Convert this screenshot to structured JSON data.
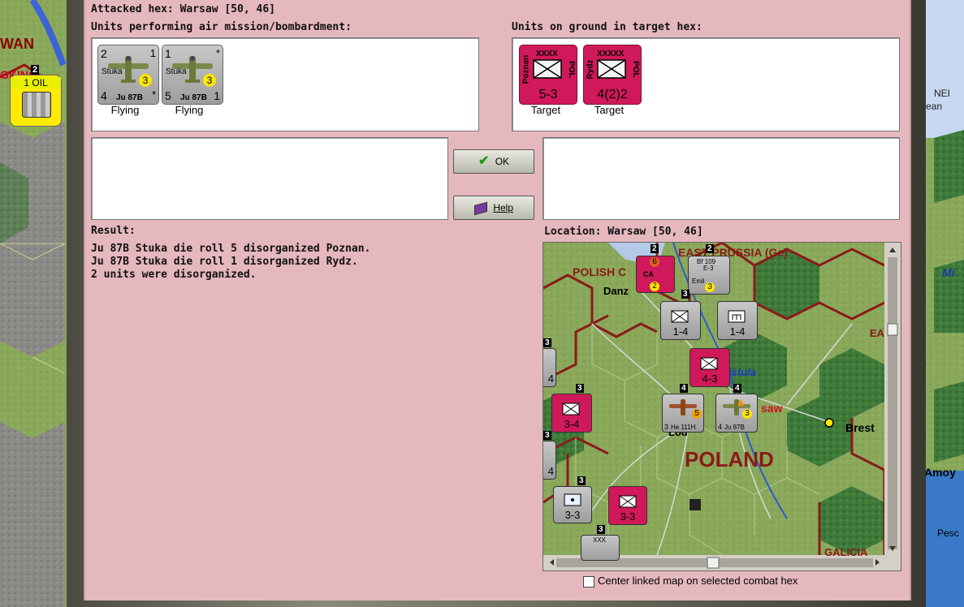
{
  "dialog": {
    "attacked_hex": "Attacked hex: Warsaw  [50, 46]",
    "air_units_header": "Units performing air mission/bombardment:",
    "ground_units_header": "Units on ground in target hex:",
    "result_header": "Result:",
    "location_header": "Location:  Warsaw  [50, 46]",
    "ok_label": "OK",
    "help_label": "Help",
    "center_checkbox_label": "Center linked map on selected combat hex",
    "center_checked": false
  },
  "air_units": [
    {
      "left_top": "2",
      "right_top": "1",
      "name": "Stuka",
      "model": "Ju 87B",
      "left_bottom": "4",
      "right_bottom": "*",
      "badge": "3",
      "status": "Flying"
    },
    {
      "left_top": "1",
      "right_top": "*",
      "name": "Stuka",
      "model": "Ju 87B",
      "left_bottom": "5",
      "right_bottom": "1",
      "badge": "3",
      "status": "Flying"
    }
  ],
  "ground_units": [
    {
      "name": "Poznan",
      "size": "XXXX",
      "nation": "POL",
      "strength": "5-3",
      "status": "Target"
    },
    {
      "name": "Rydz",
      "size": "XXXXX",
      "nation": "POL",
      "strength": "4(2)2",
      "status": "Target"
    }
  ],
  "results": [
    "Ju 87B Stuka die roll 5 disorganized Poznan.",
    "Ju 87B Stuka die roll 1 disorganized Rydz.",
    "2 units were disorganized."
  ],
  "background_map": {
    "left_labels": [
      "WAN",
      "GKING"
    ],
    "oil_label": "1 OIL",
    "oil_count": "2",
    "right_labels": [
      "Mi",
      "NEI",
      "ean",
      "Amoy",
      "Pesc"
    ]
  },
  "linked_map": {
    "labels": {
      "east_prussia": "EAST PRUSSIA (Ge)",
      "polish_corridor": "POLISH C",
      "danzig": "Danz",
      "vistula": "istula",
      "warsaw": "saw",
      "brest": "Brest",
      "lodz": "Lod",
      "poland": "POLAND",
      "galicia": "GALICIA",
      "ea": "EA"
    },
    "counters": [
      {
        "id": "gd",
        "stack": "2",
        "top": "6",
        "bottom": "2",
        "text": "CA"
      },
      {
        "id": "bf",
        "stack": "2",
        "top": "Bf 109",
        "mid": "E-3",
        "bottom": "3",
        "text": "Emil"
      },
      {
        "id": "inf1",
        "stack": "3",
        "strength": "1-4",
        "size": "XX"
      },
      {
        "id": "inf2",
        "stack": "",
        "strength": "1-4",
        "size": "XX"
      },
      {
        "id": "pol1",
        "stack": "",
        "strength": "4-3",
        "size": "XXXX"
      },
      {
        "id": "pol2",
        "stack": "3",
        "strength": "3-4",
        "size": "XXX"
      },
      {
        "id": "he",
        "stack": "4",
        "model": "He 111H",
        "left_bottom": "3",
        "badge": "5"
      },
      {
        "id": "stuka",
        "stack": "4",
        "model": "Ju 87B",
        "left_bottom": "4",
        "badge": "3"
      },
      {
        "id": "pol3",
        "stack": "3",
        "strength": "3-3",
        "size": "XX"
      },
      {
        "id": "pol4",
        "stack": "",
        "strength": "3-3",
        "size": "XXXX"
      },
      {
        "id": "edge1",
        "stack": "3",
        "strength": "4"
      },
      {
        "id": "edge2",
        "stack": "3",
        "strength": "4"
      },
      {
        "id": "bottom",
        "stack": "3",
        "size": "XXX"
      }
    ]
  },
  "colors": {
    "dialog_bg": "#e5b8be",
    "pol_unit": "#d0195a",
    "air_unit": "#b0b0b0",
    "badge": "#ffe600",
    "border": "#8b1a1a"
  }
}
